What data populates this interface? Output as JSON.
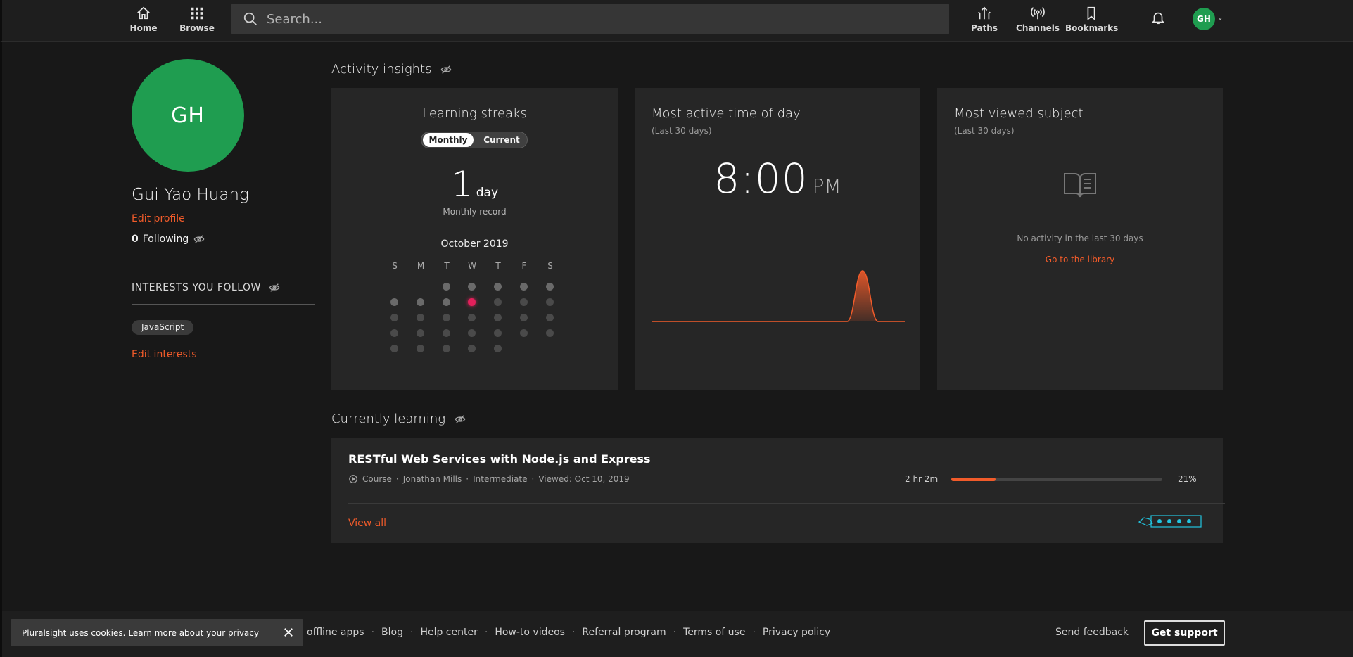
{
  "nav": {
    "home": "Home",
    "browse": "Browse",
    "search_placeholder": "Search...",
    "paths": "Paths",
    "channels": "Channels",
    "bookmarks": "Bookmarks",
    "avatar_initials": "GH"
  },
  "profile": {
    "initials": "GH",
    "name": "Gui Yao Huang",
    "edit_profile": "Edit profile",
    "following_count": "0",
    "following_label": "Following",
    "interests_title": "INTERESTS YOU FOLLOW",
    "interests": [
      "JavaScript"
    ],
    "edit_interests": "Edit interests"
  },
  "activity": {
    "title": "Activity insights",
    "streaks": {
      "title": "Learning streaks",
      "toggle_on": "Monthly",
      "toggle_off": "Current",
      "value": "1",
      "unit": "day",
      "caption": "Monthly record",
      "month": "October 2019",
      "weekdays": [
        "S",
        "M",
        "T",
        "W",
        "T",
        "F",
        "S"
      ],
      "today_day": 9
    },
    "active_time": {
      "title": "Most active time of day",
      "subtitle": "(Last 30 days)",
      "time": "8:00",
      "ampm": "PM",
      "accent": "#f15b2a"
    },
    "subject": {
      "title": "Most viewed subject",
      "subtitle": "(Last 30 days)",
      "empty": "No activity in the last 30 days",
      "link": "Go to the library"
    }
  },
  "learning": {
    "title": "Currently learning",
    "course": {
      "title": "RESTful Web Services with Node.js and Express",
      "type": "Course",
      "author": "Jonathan Mills",
      "level": "Intermediate",
      "viewed": "Viewed: Oct 10, 2019",
      "duration": "2 hr 2m",
      "progress": 0.21,
      "progress_label": "21%"
    },
    "view_all": "View all"
  },
  "footer": {
    "links": [
      "offline apps",
      "Blog",
      "Help center",
      "How-to videos",
      "Referral program",
      "Terms of use",
      "Privacy policy"
    ],
    "feedback": "Send feedback",
    "support": "Get support"
  },
  "cookie": {
    "text": "Pluralsight uses cookies.",
    "link": "Learn more about your privacy"
  },
  "colors": {
    "brand_orange": "#f15b2a",
    "avatar_green": "#1f9d50",
    "today_pink": "#e3205b"
  }
}
